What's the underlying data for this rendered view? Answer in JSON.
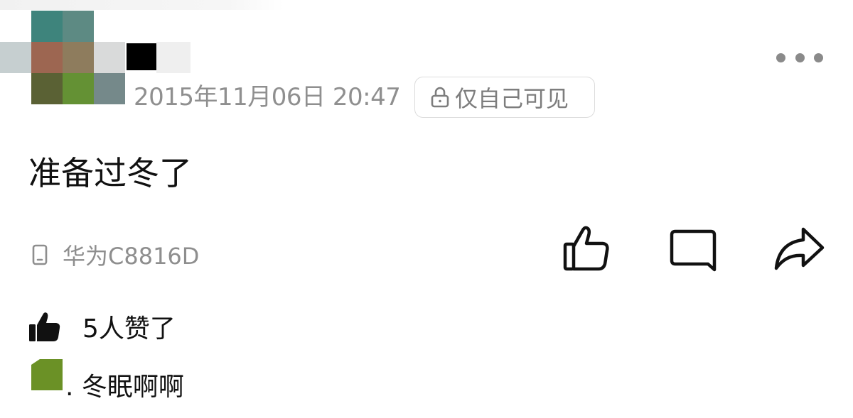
{
  "post": {
    "timestamp": "2015年11月06日 20:47",
    "privacy_label": "仅自己可见",
    "text": "准备过冬了",
    "device": "华为C8816D"
  },
  "icons": {
    "more": "more-dots-icon",
    "lock": "lock-icon",
    "device": "phone-icon",
    "like": "thumbs-up-icon",
    "comment": "comment-bubble-icon",
    "share": "share-arrow-icon",
    "likes_indicator": "thumbs-up-filled-icon"
  },
  "likes": {
    "text": "5人赞了"
  },
  "comment": {
    "text": ". 冬眠啊啊"
  },
  "colors": {
    "avatar_pixels": [
      "#3e847c",
      "#5d8a83",
      "#9d6651",
      "#8e7c5d",
      "#d9dada",
      "#000000",
      "#5a6134",
      "#649134",
      "#75898a"
    ],
    "comment_avatar": "#6b9126"
  }
}
